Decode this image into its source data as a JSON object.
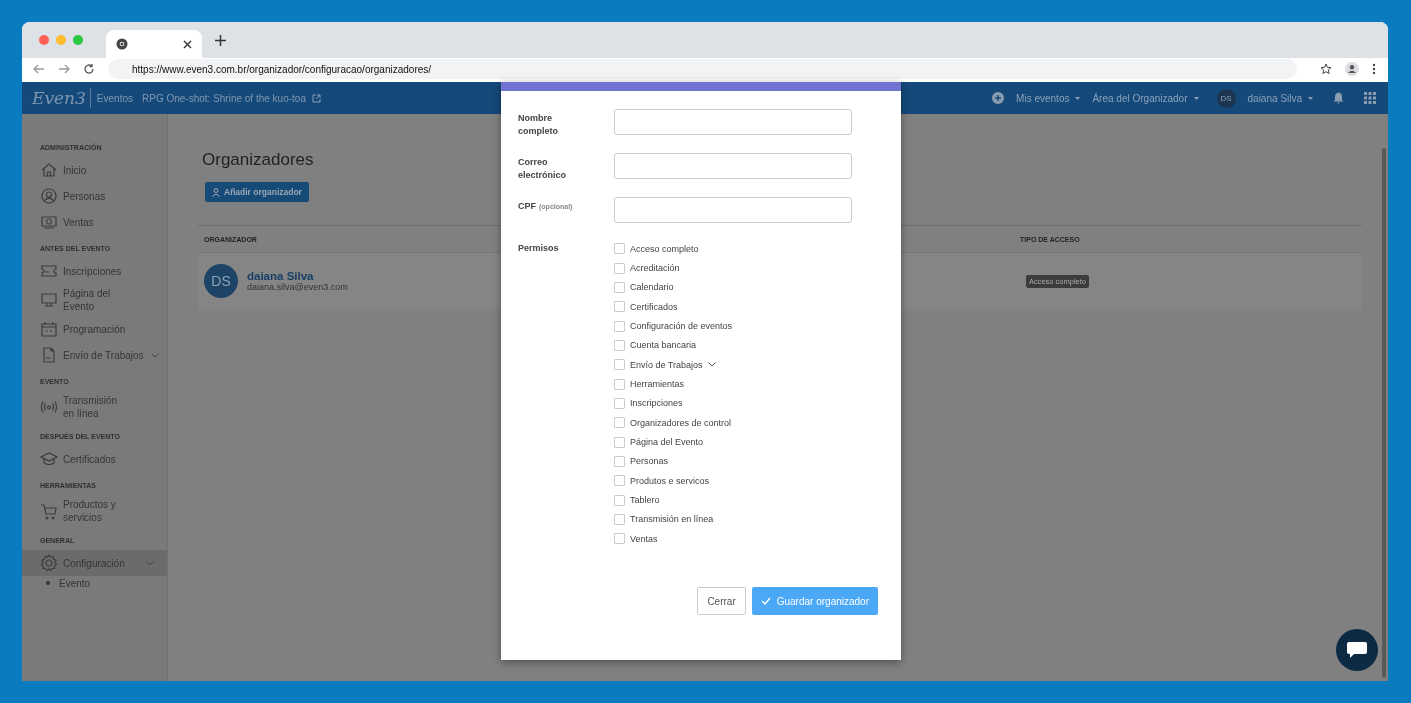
{
  "browser": {
    "url": "https://www.even3.com.br/organizador/configuracao/organizadores/"
  },
  "header": {
    "logo": "Even3",
    "section": "Eventos",
    "event": "RPG One-shot: Shrine of the kuo-toa",
    "menus": [
      {
        "label": "Mis eventos"
      },
      {
        "label": "Área del Organizador"
      }
    ],
    "user": {
      "initials": "DS",
      "name": "daiana Silva"
    }
  },
  "sidebar": {
    "sections": [
      {
        "title": "ADMINISTRACIÓN",
        "items": [
          {
            "label": "Inicio",
            "selected": false,
            "expandable": false
          },
          {
            "label": "Personas",
            "selected": false,
            "expandable": false
          },
          {
            "label": "Ventas",
            "selected": false,
            "expandable": false
          }
        ]
      },
      {
        "title": "ANTES DEL EVENTO",
        "items": [
          {
            "label": "Inscripciones",
            "selected": false,
            "expandable": false
          },
          {
            "label": "Página del Evento",
            "selected": false,
            "expandable": false
          },
          {
            "label": "Programación",
            "selected": false,
            "expandable": false
          },
          {
            "label": "Envío de Trabajos",
            "selected": false,
            "expandable": true
          }
        ]
      },
      {
        "title": "EVENTO",
        "items": [
          {
            "label": "Transmisión en línea",
            "selected": false,
            "expandable": false
          }
        ]
      },
      {
        "title": "DESPUÉS DEL EVENTO",
        "items": [
          {
            "label": "Certificados",
            "selected": false,
            "expandable": false
          }
        ]
      },
      {
        "title": "HERRAMIENTAS",
        "items": [
          {
            "label": "Productos y servicios",
            "selected": false,
            "expandable": false
          }
        ]
      },
      {
        "title": "GENERAL",
        "items": [
          {
            "label": "Configuración",
            "selected": true,
            "expandable": true,
            "children": [
              {
                "label": "Evento"
              }
            ]
          }
        ]
      }
    ]
  },
  "page": {
    "title": "Organizadores",
    "add_button": "Añadir organizador",
    "table": {
      "columns": [
        "ORGANIZADOR",
        "TIPO DE ACCESO"
      ],
      "rows": [
        {
          "initials": "DS",
          "name": "daiana Silva",
          "email": "daiana.silva@even3.com",
          "access": "Acceso completo"
        }
      ]
    }
  },
  "modal": {
    "fields": [
      {
        "label": "Nombre completo"
      },
      {
        "label": "Correo electrónico"
      },
      {
        "label": "CPF",
        "note": "(opcional)"
      }
    ],
    "permissions_label": "Permisos",
    "permissions": [
      {
        "label": "Acceso completo",
        "checked": false,
        "expandable": false
      },
      {
        "label": "Acreditación",
        "checked": false,
        "expandable": false
      },
      {
        "label": "Calendario",
        "checked": false,
        "expandable": false
      },
      {
        "label": "Certificados",
        "checked": false,
        "expandable": false
      },
      {
        "label": "Configuración de eventos",
        "checked": false,
        "expandable": false
      },
      {
        "label": "Cuenta bancaria",
        "checked": false,
        "expandable": false
      },
      {
        "label": "Envío de Trabajos",
        "checked": false,
        "expandable": true
      },
      {
        "label": "Herramientas",
        "checked": false,
        "expandable": false
      },
      {
        "label": "Inscripciones",
        "checked": false,
        "expandable": false
      },
      {
        "label": "Organizadores de control",
        "checked": false,
        "expandable": false
      },
      {
        "label": "Página del Evento",
        "checked": false,
        "expandable": false
      },
      {
        "label": "Personas",
        "checked": false,
        "expandable": false
      },
      {
        "label": "Produtos e servicos",
        "checked": false,
        "expandable": false
      },
      {
        "label": "Tablero",
        "checked": false,
        "expandable": false
      },
      {
        "label": "Transmisión en línea",
        "checked": false,
        "expandable": false
      },
      {
        "label": "Ventas",
        "checked": false,
        "expandable": false
      }
    ],
    "buttons": [
      {
        "label": "Cerrar",
        "kind": "secondary"
      },
      {
        "label": "Guardar organizador",
        "kind": "primary"
      }
    ]
  }
}
